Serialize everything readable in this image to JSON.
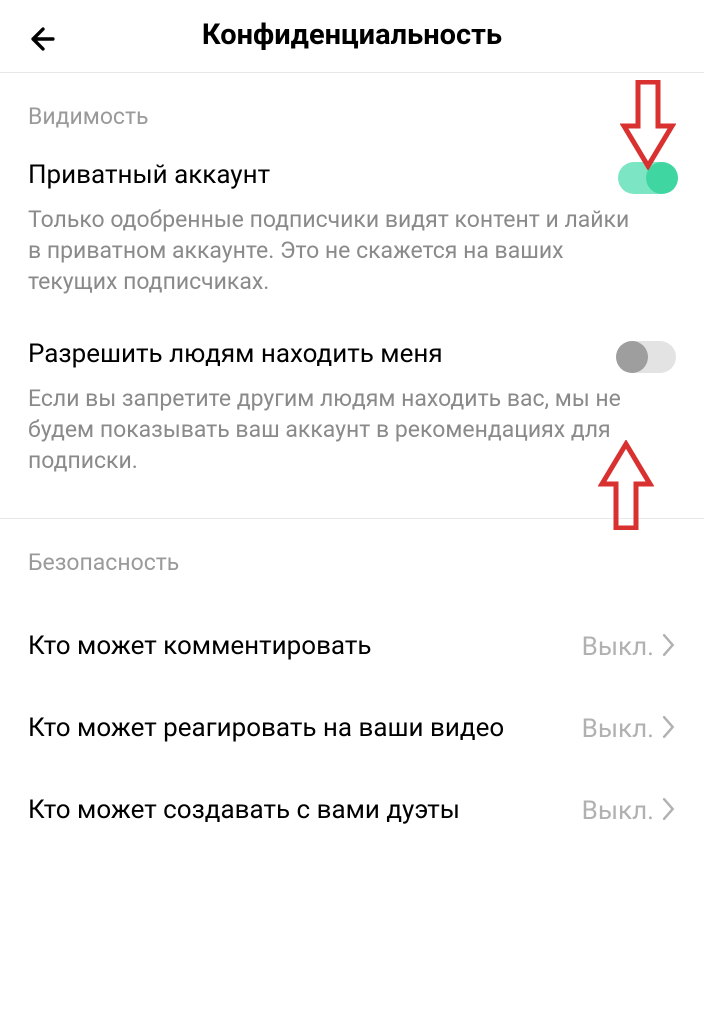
{
  "header": {
    "title": "Конфиденциальность"
  },
  "sections": {
    "visibility": {
      "header": "Видимость",
      "private_account": {
        "title": "Приватный аккаунт",
        "desc": "Только одобренные подписчики видят контент и лайки в приватном аккаунте. Это не скажется на ваших текущих подписчиках.",
        "enabled": true
      },
      "allow_find": {
        "title": "Разрешить людям находить меня",
        "desc": "Если вы запретите другим людям находить вас, мы не будем показывать ваш аккаунт в рекомендациях для подписки.",
        "enabled": false
      }
    },
    "security": {
      "header": "Безопасность",
      "who_comment": {
        "title": "Кто может комментировать",
        "value": "Выкл."
      },
      "who_react": {
        "title": "Кто может реагировать на ваши видео",
        "value": "Выкл."
      },
      "who_duet": {
        "title": "Кто может создавать с вами дуэты",
        "value": "Выкл."
      }
    }
  },
  "colors": {
    "toggle_on_bg": "#7ce6c4",
    "toggle_on_knob": "#40d6a2",
    "toggle_off_bg": "#e3e3e3",
    "toggle_off_knob": "#9e9e9e",
    "annotation_red": "#d93030"
  }
}
